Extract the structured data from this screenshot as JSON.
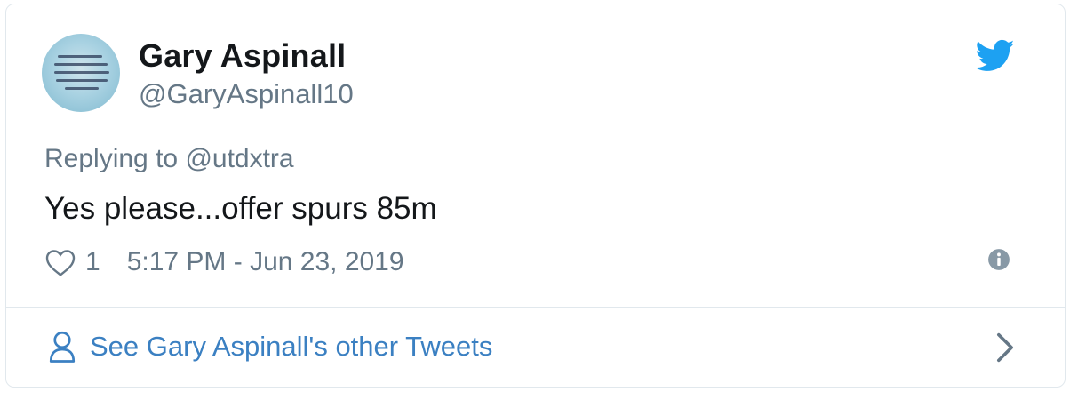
{
  "tweet": {
    "author": {
      "display_name": "Gary Aspinall",
      "handle": "@GaryAspinall10"
    },
    "reply": {
      "prefix": "Replying to",
      "to_handle": "@utdxtra"
    },
    "text": "Yes please...offer spurs 85m",
    "likes": "1",
    "timestamp": "5:17 PM - Jun 23, 2019",
    "see_more_label": "See Gary Aspinall's other Tweets"
  },
  "icons": {
    "brand": "twitter-bird-icon",
    "like": "heart-icon",
    "info": "info-icon",
    "profile": "person-icon",
    "next": "chevron-right-icon"
  },
  "colors": {
    "twitter_blue": "#1da1f2",
    "link_blue": "#3b80c2",
    "secondary_text": "#657786",
    "primary_text": "#14171a",
    "border": "#e1e8ed"
  }
}
